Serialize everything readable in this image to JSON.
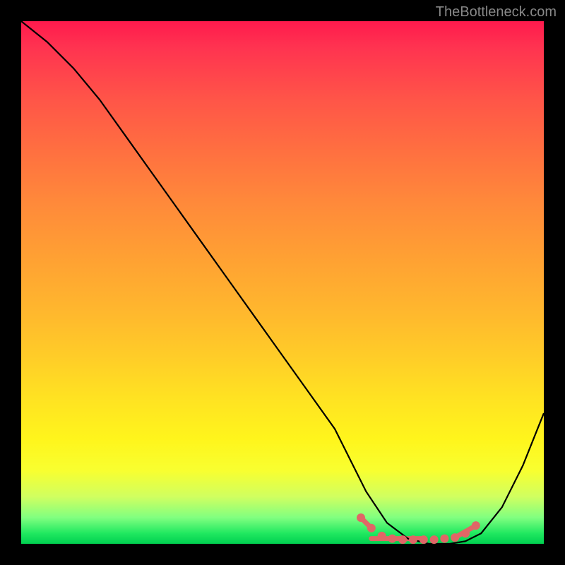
{
  "watermark": "TheBottleneck.com",
  "chart_data": {
    "type": "line",
    "title": "",
    "xlabel": "",
    "ylabel": "",
    "xlim": [
      0,
      100
    ],
    "ylim": [
      0,
      100
    ],
    "series": [
      {
        "name": "curve",
        "color": "#000000",
        "x": [
          0,
          5,
          10,
          15,
          20,
          25,
          30,
          35,
          40,
          45,
          50,
          55,
          60,
          63,
          66,
          70,
          74,
          78,
          82,
          85,
          88,
          92,
          96,
          100
        ],
        "values": [
          100,
          96,
          91,
          85,
          78,
          71,
          64,
          57,
          50,
          43,
          36,
          29,
          22,
          16,
          10,
          4,
          1,
          0,
          0,
          0.5,
          2,
          7,
          15,
          25
        ]
      }
    ],
    "markers": {
      "name": "highlight-dots",
      "color": "#e06666",
      "radius": 6,
      "x": [
        65,
        67,
        69,
        71,
        73,
        75,
        77,
        79,
        81,
        83,
        85,
        87
      ],
      "values": [
        5,
        3,
        1.5,
        1,
        0.8,
        0.8,
        0.8,
        0.8,
        1,
        1.2,
        2,
        3.5
      ]
    },
    "marker_segments": [
      {
        "x": [
          65,
          67
        ],
        "values": [
          5,
          3
        ]
      },
      {
        "x": [
          67,
          77
        ],
        "values": [
          1,
          1
        ]
      },
      {
        "x": [
          83,
          87
        ],
        "values": [
          1.2,
          3.5
        ]
      }
    ]
  }
}
